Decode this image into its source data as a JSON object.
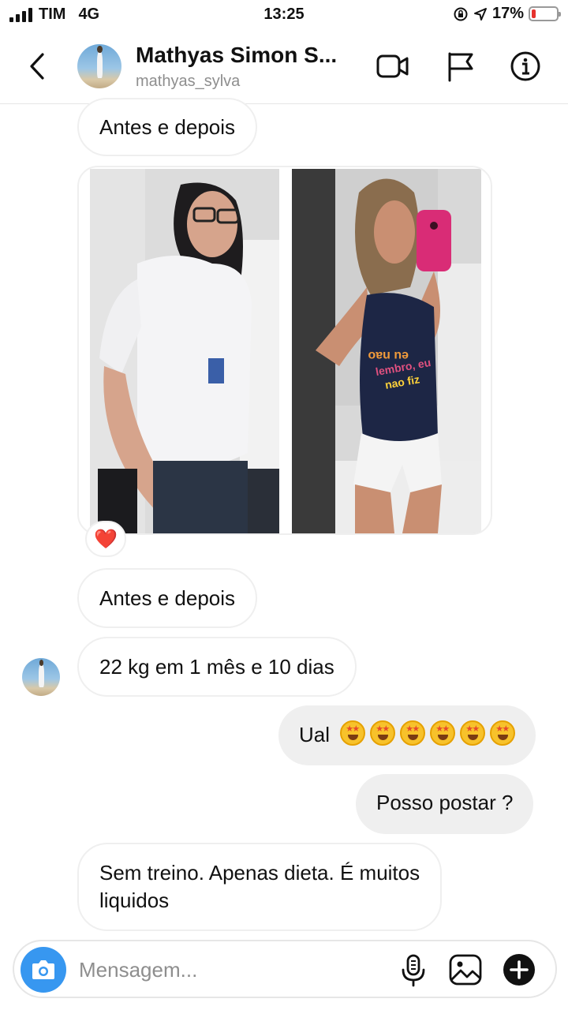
{
  "status_bar": {
    "carrier": "TIM",
    "network": "4G",
    "time": "13:25",
    "battery_percent": "17%",
    "battery_level": 0.17
  },
  "header": {
    "name": "Mathyas Simon S...",
    "username": "mathyas_sylva"
  },
  "icons": {
    "back": "chevron-left-icon",
    "video": "video-camera-icon",
    "report": "flag-icon",
    "info": "info-icon",
    "camera": "camera-icon",
    "mic": "microphone-icon",
    "gallery": "image-icon",
    "more": "plus-circle-icon",
    "reaction": "heart-icon"
  },
  "messages": [
    {
      "direction": "in",
      "text": "Antes e depois"
    },
    {
      "direction": "in",
      "type": "photo",
      "reaction": "❤️"
    },
    {
      "direction": "in",
      "text": "Antes e depois"
    },
    {
      "direction": "in",
      "text": "22 kg em 1 mês e 10 dias"
    },
    {
      "direction": "out",
      "text": "Ual",
      "emoji_count": 6,
      "emoji": "star-struck"
    },
    {
      "direction": "out",
      "text": "Posso postar ?"
    },
    {
      "direction": "in",
      "text_line1": "Sem treino. Apenas dieta. É muitos",
      "text_line2": "liquidos"
    }
  ],
  "photo_shirt_text": [
    "eu nao",
    "lembro, eu",
    "nao fiz"
  ],
  "composer": {
    "placeholder": "Mensagem..."
  },
  "colors": {
    "accent": "#3797f0",
    "incoming_border": "#efefef",
    "outgoing_bg": "#efefef",
    "battery_low": "#e5322d"
  }
}
